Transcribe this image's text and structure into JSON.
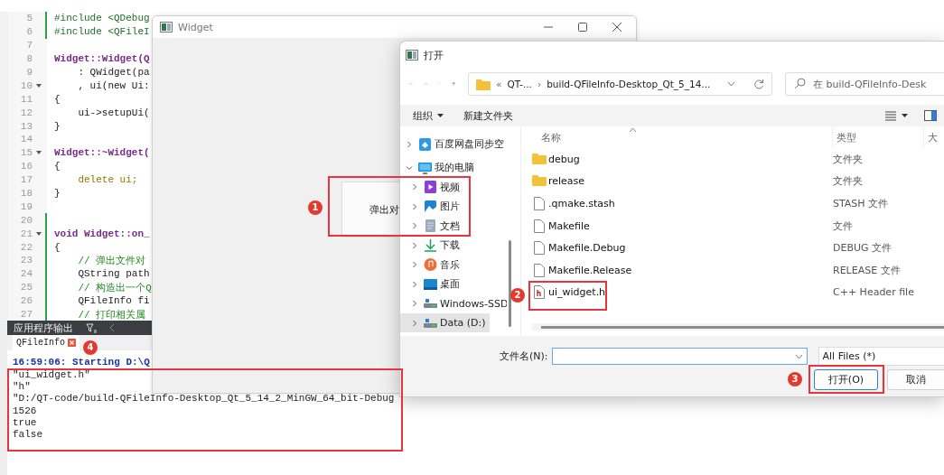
{
  "editor": {
    "lines": [
      {
        "number": "5",
        "text": "#include <QDebug",
        "kind": "preprocessor",
        "changed": true,
        "foldable": false
      },
      {
        "number": "6",
        "text": "#include <QFileI",
        "kind": "preprocessor",
        "changed": true,
        "foldable": false
      },
      {
        "number": "7",
        "kind": "code",
        "changed": false,
        "foldable": false
      },
      {
        "number": "8",
        "text": "Widget::Widget(Q",
        "kind": "signature",
        "changed": false,
        "foldable": false
      },
      {
        "number": "9",
        "text": "    : QWidget(pa",
        "kind": "code",
        "changed": false,
        "foldable": false
      },
      {
        "number": "10",
        "text": "    , ui(new Ui:",
        "kind": "code",
        "changed": false,
        "foldable": true
      },
      {
        "number": "11",
        "text": "{",
        "kind": "code",
        "changed": false,
        "foldable": false
      },
      {
        "number": "12",
        "text": "    ui->setupUi(",
        "kind": "code",
        "changed": false,
        "foldable": false
      },
      {
        "number": "13",
        "text": "}",
        "kind": "code",
        "changed": false,
        "foldable": false
      },
      {
        "number": "14",
        "kind": "code",
        "changed": false,
        "foldable": false
      },
      {
        "number": "15",
        "text": "Widget::~Widget(",
        "kind": "signature",
        "changed": false,
        "foldable": true
      },
      {
        "number": "16",
        "text": "{",
        "kind": "code",
        "changed": false,
        "foldable": false
      },
      {
        "number": "17",
        "text": "    delete ui;",
        "kind": "keyword",
        "changed": false,
        "foldable": false
      },
      {
        "number": "18",
        "text": "}",
        "kind": "code",
        "changed": false,
        "foldable": false
      },
      {
        "number": "19",
        "kind": "code",
        "changed": false,
        "foldable": false
      },
      {
        "number": "20",
        "kind": "code",
        "changed": true,
        "foldable": false
      },
      {
        "number": "21",
        "text": "void Widget::on_",
        "kind": "signature",
        "changed": true,
        "foldable": true
      },
      {
        "number": "22",
        "text": "{",
        "kind": "code",
        "changed": true,
        "foldable": false
      },
      {
        "number": "23",
        "text": "    // 弹出文件对",
        "kind": "comment",
        "changed": true,
        "foldable": false
      },
      {
        "number": "24",
        "text": "    QString path",
        "kind": "code",
        "changed": true,
        "foldable": false
      },
      {
        "number": "25",
        "text": "    // 构造出一个Q",
        "kind": "comment",
        "changed": true,
        "foldable": false
      },
      {
        "number": "26",
        "text": "    QFileInfo fi",
        "kind": "code",
        "changed": true,
        "foldable": false
      },
      {
        "number": "27",
        "text": "    // 打印相关属",
        "kind": "comment",
        "changed": true,
        "foldable": false
      }
    ]
  },
  "output_pane": {
    "title": "应用程序输出",
    "tabs": [
      {
        "label": "QFileInfo",
        "selected": true
      }
    ],
    "lines": [
      {
        "text": "16:59:06: Starting D:\\Q",
        "kind": "status"
      },
      {
        "text": "\"ui_widget.h\"",
        "kind": "plain"
      },
      {
        "text": "\"h\"",
        "kind": "plain"
      },
      {
        "text": "\"D:/QT-code/build-QFileInfo-Desktop_Qt_5_14_2_MinGW_64_bit-Debug",
        "kind": "plain"
      },
      {
        "text": "1526",
        "kind": "plain"
      },
      {
        "text": "true",
        "kind": "plain"
      },
      {
        "text": "false",
        "kind": "plain"
      }
    ]
  },
  "widget_window": {
    "title": "Widget",
    "button": "弹出对"
  },
  "open_dialog": {
    "title": "打开",
    "address": [
      "«",
      "QT-...",
      "›",
      "build-QFileInfo-Desktop_Qt_5_14..."
    ],
    "search": {
      "placeholder": "在 build-QFileInfo-Desk"
    },
    "toolbar": [
      "组织",
      "新建文件夹"
    ],
    "tree": [
      {
        "label": "百度网盘同步空",
        "kind": "cloud",
        "expanded": false,
        "selected": false
      },
      {
        "label": "我的电脑",
        "kind": "computer",
        "expanded": true,
        "selected": false,
        "children": [
          {
            "label": "视频",
            "kind": "video",
            "expanded": false,
            "selected": false
          },
          {
            "label": "图片",
            "kind": "image",
            "expanded": false,
            "selected": false
          },
          {
            "label": "文档",
            "kind": "document",
            "expanded": false,
            "selected": false
          },
          {
            "label": "下载",
            "kind": "download",
            "expanded": false,
            "selected": false
          },
          {
            "label": "音乐",
            "kind": "music",
            "expanded": false,
            "selected": false
          },
          {
            "label": "桌面",
            "kind": "desktop",
            "expanded": false,
            "selected": false
          },
          {
            "label": "Windows-SSD",
            "kind": "drive",
            "expanded": false,
            "selected": false
          },
          {
            "label": "Data (D:)",
            "kind": "drive",
            "expanded": false,
            "selected": true
          }
        ]
      }
    ],
    "columns": [
      "名称",
      "类型",
      "大"
    ],
    "files": [
      {
        "name": "debug",
        "type": "文件夹",
        "kind": "folder",
        "selected": false
      },
      {
        "name": "release",
        "type": "文件夹",
        "kind": "folder",
        "selected": false
      },
      {
        "name": ".qmake.stash",
        "type": "STASH 文件",
        "kind": "file",
        "selected": false
      },
      {
        "name": "Makefile",
        "type": "文件",
        "kind": "file",
        "selected": false
      },
      {
        "name": "Makefile.Debug",
        "type": "DEBUG 文件",
        "kind": "file",
        "selected": false
      },
      {
        "name": "Makefile.Release",
        "type": "RELEASE 文件",
        "kind": "file",
        "selected": false
      },
      {
        "name": "ui_widget.h",
        "type": "C++ Header file",
        "kind": "header",
        "selected": false
      }
    ],
    "file_name": {
      "label": "文件名(N):"
    },
    "filter": "All Files  (*)",
    "buttons": [
      {
        "label": "打开(O)",
        "kind": "default"
      },
      {
        "label": "取消",
        "kind": "normal"
      }
    ]
  },
  "annotations": [
    {
      "label": "1"
    },
    {
      "label": "2"
    },
    {
      "label": "3"
    },
    {
      "label": "4"
    }
  ]
}
